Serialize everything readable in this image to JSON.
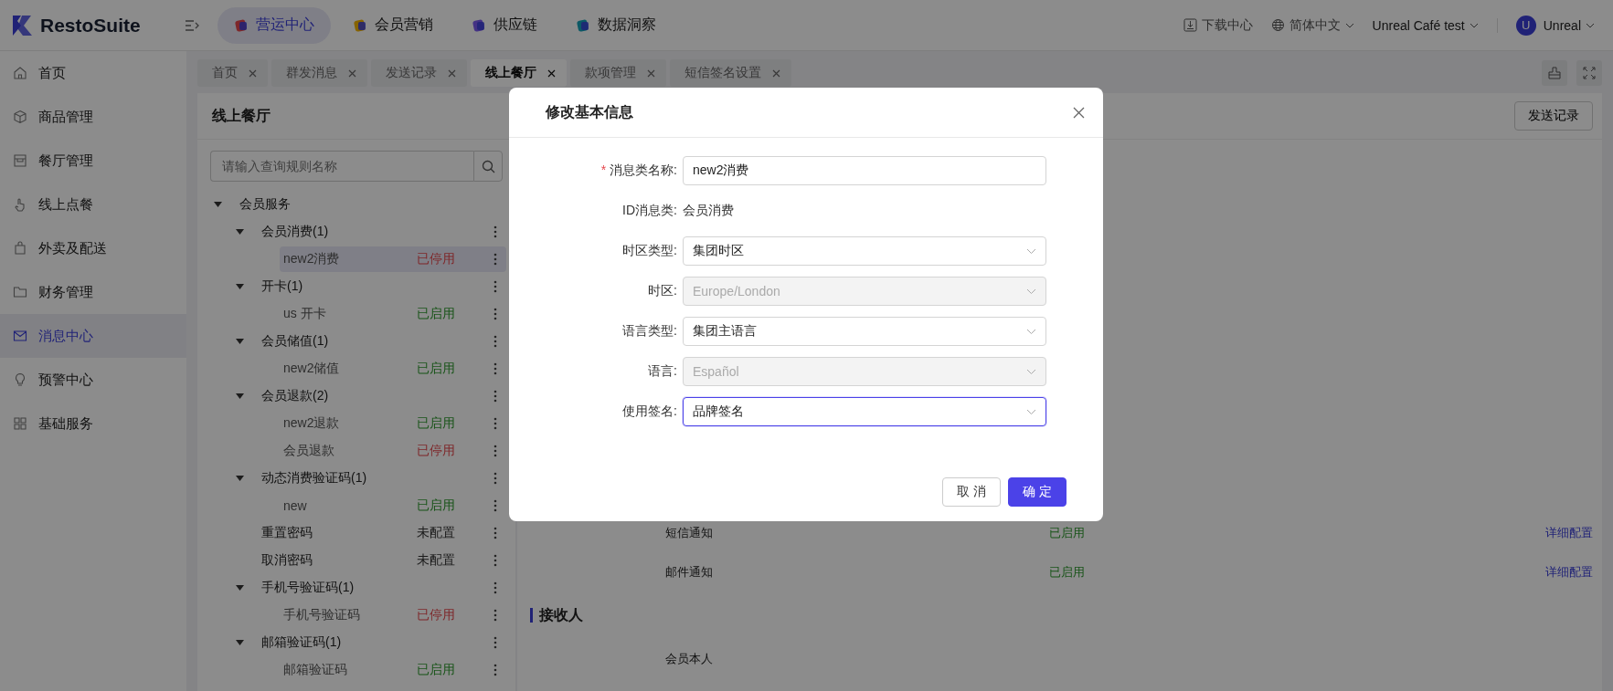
{
  "header": {
    "logo": "RestoSuite",
    "nav": [
      {
        "label": "营运中心",
        "selected": true
      },
      {
        "label": "会员营销",
        "selected": false
      },
      {
        "label": "供应链",
        "selected": false
      },
      {
        "label": "数据洞察",
        "selected": false
      }
    ],
    "download": "下载中心",
    "language": "简体中文",
    "store": "Unreal Café test",
    "avatar": "U",
    "user": "Unreal"
  },
  "sidebar": {
    "items": [
      {
        "label": "首页",
        "selected": false
      },
      {
        "label": "商品管理",
        "selected": false
      },
      {
        "label": "餐厅管理",
        "selected": false
      },
      {
        "label": "线上点餐",
        "selected": false
      },
      {
        "label": "外卖及配送",
        "selected": false
      },
      {
        "label": "财务管理",
        "selected": false
      },
      {
        "label": "消息中心",
        "selected": true
      },
      {
        "label": "预警中心",
        "selected": false
      },
      {
        "label": "基础服务",
        "selected": false
      }
    ]
  },
  "tabs": [
    {
      "label": "首页",
      "selected": false
    },
    {
      "label": "群发消息",
      "selected": false
    },
    {
      "label": "发送记录",
      "selected": false
    },
    {
      "label": "线上餐厅",
      "selected": true
    },
    {
      "label": "款项管理",
      "selected": false
    },
    {
      "label": "短信签名设置",
      "selected": false
    }
  ],
  "tree_panel": {
    "title": "线上餐厅",
    "search": {
      "placeholder": "请输入查询规则名称"
    },
    "tree": [
      {
        "label": "会员服务",
        "expanded": true,
        "children": [
          {
            "label": "会员消费(1)",
            "expanded": true,
            "children": [
              {
                "label": "new2消费",
                "status": "已停用",
                "kind": "disabled",
                "selected": true
              }
            ]
          },
          {
            "label": "开卡(1)",
            "expanded": true,
            "children": [
              {
                "label": "us 开卡",
                "status": "已启用",
                "kind": "enabled",
                "selected": false
              }
            ]
          },
          {
            "label": "会员储值(1)",
            "expanded": true,
            "children": [
              {
                "label": "new2储值",
                "status": "已启用",
                "kind": "enabled",
                "selected": false
              }
            ]
          },
          {
            "label": "会员退款(2)",
            "expanded": true,
            "children": [
              {
                "label": "new2退款",
                "status": "已启用",
                "kind": "enabled",
                "selected": false
              },
              {
                "label": "会员退款",
                "status": "已停用",
                "kind": "disabled",
                "selected": false
              }
            ]
          },
          {
            "label": "动态消费验证码(1)",
            "expanded": true,
            "children": [
              {
                "label": "new",
                "status": "已启用",
                "kind": "enabled",
                "selected": false
              }
            ]
          },
          {
            "label": "重置密码",
            "status": "未配置",
            "kind": "unset",
            "selected": false
          },
          {
            "label": "取消密码",
            "status": "未配置",
            "kind": "unset",
            "selected": false
          },
          {
            "label": "手机号验证码(1)",
            "expanded": true,
            "children": [
              {
                "label": "手机号验证码",
                "status": "已停用",
                "kind": "disabled",
                "selected": false
              }
            ]
          },
          {
            "label": "邮箱验证码(1)",
            "expanded": true,
            "children": [
              {
                "label": "邮箱验证码",
                "status": "已启用",
                "kind": "enabled",
                "selected": false
              }
            ]
          }
        ]
      }
    ]
  },
  "detail": {
    "record_button": "发送记录",
    "channels": [
      {
        "name": "短信通知",
        "status": "已启用",
        "action": "详细配置"
      },
      {
        "name": "邮件通知",
        "status": "已启用",
        "action": "详细配置"
      }
    ],
    "recipients_title": "接收人",
    "recipients": [
      "会员本人"
    ]
  },
  "dialog": {
    "title": "修改基本信息",
    "fields": [
      {
        "label": "消息类名称:",
        "kind": "input",
        "value": "new2消费",
        "required_mark": "*",
        "disabled": false,
        "focused": false
      },
      {
        "label": "ID消息类:",
        "kind": "static",
        "value": "会员消费"
      },
      {
        "label": "时区类型:",
        "kind": "select",
        "value": "集团时区",
        "disabled": false,
        "focused": false
      },
      {
        "label": "时区:",
        "kind": "select",
        "value": "Europe/London",
        "disabled": true,
        "focused": false
      },
      {
        "label": "语言类型:",
        "kind": "select",
        "value": "集团主语言",
        "disabled": false,
        "focused": false
      },
      {
        "label": "语言:",
        "kind": "select",
        "value": "Español",
        "disabled": true,
        "focused": false
      },
      {
        "label": "使用签名:",
        "kind": "select",
        "value": "品牌签名",
        "disabled": false,
        "focused": true
      }
    ],
    "cancel": "取 消",
    "confirm": "确 定"
  }
}
